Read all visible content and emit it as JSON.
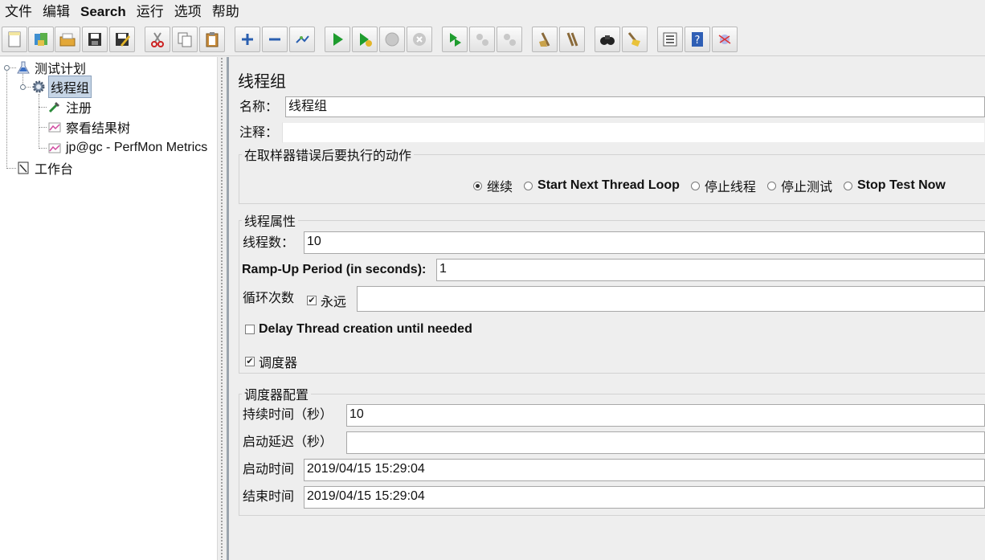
{
  "menu": {
    "items": [
      {
        "label": "文件",
        "bold": false
      },
      {
        "label": "编辑",
        "bold": false
      },
      {
        "label": "Search",
        "bold": true
      },
      {
        "label": "运行",
        "bold": false
      },
      {
        "label": "选项",
        "bold": false
      },
      {
        "label": "帮助",
        "bold": false
      }
    ]
  },
  "toolbar": {
    "buttons": [
      "new-icon",
      "templates-icon",
      "open-icon",
      "save-icon",
      "save-as-icon",
      "cut-icon",
      "copy-icon",
      "paste-icon",
      "expand-icon",
      "collapse-icon",
      "toggle-icon",
      "start-icon",
      "start-no-pause-icon",
      "stop-icon",
      "shutdown-icon",
      "remote-start-icon",
      "remote-stop-icon",
      "remote-shutdown-icon",
      "clear-icon",
      "clear-all-icon",
      "search-icon",
      "reset-search-icon",
      "function-helper-icon",
      "help-icon",
      "log-icon"
    ]
  },
  "tree": {
    "test_plan": "测试计划",
    "thread_group": "线程组",
    "register": "注册",
    "results_tree": "察看结果树",
    "perfmon": "jp@gc - PerfMon Metrics",
    "workbench": "工作台"
  },
  "panel": {
    "title": "线程组",
    "name_label": "名称：",
    "name_value": "线程组",
    "comment_label": "注释：",
    "comment_value": "",
    "error_action": {
      "legend": "在取样器错误后要执行的动作",
      "options": [
        {
          "label": "继续",
          "bold": false,
          "selected": true
        },
        {
          "label": "Start Next Thread Loop",
          "bold": true,
          "selected": false
        },
        {
          "label": "停止线程",
          "bold": false,
          "selected": false
        },
        {
          "label": "停止测试",
          "bold": false,
          "selected": false
        },
        {
          "label": "Stop Test Now",
          "bold": true,
          "selected": false
        }
      ]
    },
    "thread_props": {
      "legend": "线程属性",
      "threads_label": "线程数：",
      "threads_value": "10",
      "rampup_label": "Ramp-Up Period (in seconds):",
      "rampup_value": "1",
      "loop_label": "循环次数",
      "forever_label": "永远",
      "forever_checked": true,
      "loop_value": "",
      "delay_label": "Delay Thread creation until needed",
      "delay_checked": false,
      "scheduler_label": "调度器",
      "scheduler_checked": true
    },
    "scheduler": {
      "legend": "调度器配置",
      "duration_label": "持续时间（秒）",
      "duration_value": "10",
      "delay_label": "启动延迟（秒）",
      "delay_value": "",
      "start_label": "启动时间",
      "start_value": "2019/04/15 15:29:04",
      "end_label": "结束时间",
      "end_value": "2019/04/15 15:29:04"
    }
  }
}
